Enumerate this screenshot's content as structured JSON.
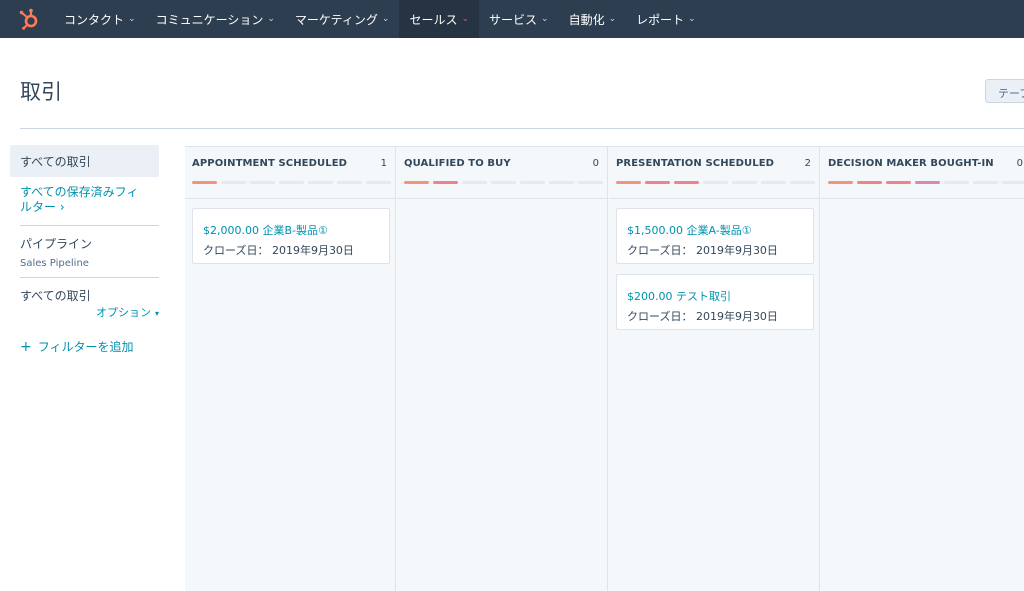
{
  "nav": {
    "items": [
      {
        "label": "コンタクト"
      },
      {
        "label": "コミュニケーション"
      },
      {
        "label": "マーケティング"
      },
      {
        "label": "セールス"
      },
      {
        "label": "サービス"
      },
      {
        "label": "自動化"
      },
      {
        "label": "レポート"
      }
    ],
    "active_index": 3,
    "chevron": "⌄"
  },
  "header": {
    "title": "取引",
    "button_label": "テーブ"
  },
  "sidebar": {
    "all_deals": "すべての取引",
    "saved_filters": "すべての保存済みフィルター ›",
    "pipeline_label": "パイプライン",
    "pipeline_value": "Sales Pipeline",
    "deals_label": "すべての取引",
    "options": "オプション",
    "add_filter": "フィルターを追加"
  },
  "board": {
    "columns": [
      {
        "name": "APPOINTMENT SCHEDULED",
        "count": "1",
        "progress": [
          1,
          0,
          0,
          0,
          0,
          0,
          0
        ],
        "cards": [
          {
            "title": "$2,000.00 企業B-製品①",
            "date": "クローズ日： 2019年9月30日"
          }
        ]
      },
      {
        "name": "QUALIFIED TO BUY",
        "count": "0",
        "progress": [
          1,
          2,
          0,
          0,
          0,
          0,
          0
        ],
        "cards": []
      },
      {
        "name": "PRESENTATION SCHEDULED",
        "count": "2",
        "progress": [
          1,
          2,
          2,
          0,
          0,
          0,
          0
        ],
        "cards": [
          {
            "title": "$1,500.00 企業A-製品①",
            "date": "クローズ日： 2019年9月30日"
          },
          {
            "title": "$200.00 テスト取引",
            "date": "クローズ日： 2019年9月30日"
          }
        ]
      },
      {
        "name": "DECISION MAKER BOUGHT-IN",
        "count": "0",
        "progress": [
          1,
          2,
          2,
          3,
          0,
          0,
          0
        ],
        "cards": []
      }
    ]
  },
  "colors": {
    "nav_bg": "#2d3e50",
    "accent_link": "#0091ae",
    "logo": "#ff7a59"
  },
  "icons": {
    "logo": "hubspot-sprocket-icon",
    "chevron": "chevron-down-icon",
    "plus": "plus-icon"
  }
}
